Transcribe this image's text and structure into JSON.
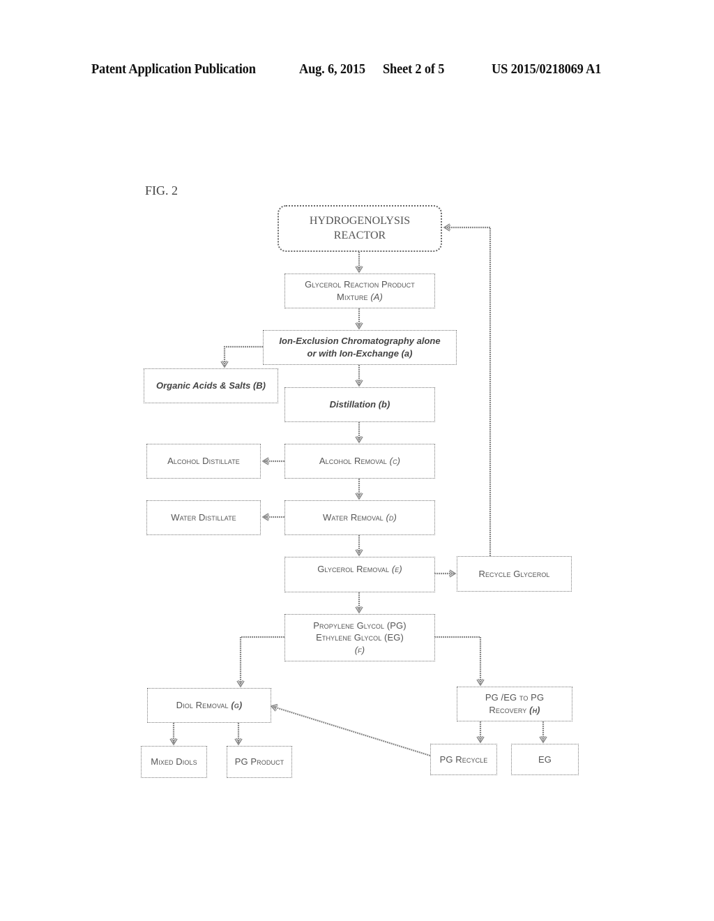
{
  "header": {
    "publication": "Patent Application Publication",
    "date": "Aug. 6, 2015",
    "sheet": "Sheet 2 of 5",
    "number": "US 2015/0218069 A1"
  },
  "figure": {
    "label": "FIG. 2"
  },
  "nodes": {
    "reactor": {
      "line1": "HYDROGENOLYSIS",
      "line2": "REACTOR"
    },
    "mixture": {
      "line1": "Glycerol Reaction Product",
      "line2": "Mixture",
      "tag": "(A)"
    },
    "ion_exclusion": {
      "line1": "Ion-Exclusion Chromatography alone",
      "line2": "or with Ion-Exchange (a)"
    },
    "organic_acids": {
      "label": "Organic Acids & Salts (B)"
    },
    "distillation": {
      "label": "Distillation (b)"
    },
    "alcohol_removal": {
      "label": "Alcohol Removal",
      "tag": "(c)"
    },
    "alcohol_distillate": {
      "label": "Alcohol Distillate"
    },
    "water_removal": {
      "label": "Water Removal",
      "tag": "(d)"
    },
    "water_distillate": {
      "label": "Water Distillate"
    },
    "glycerol_removal": {
      "label": "Glycerol Removal",
      "tag": "(e)"
    },
    "recycle_glycerol": {
      "label": "Recycle Glycerol"
    },
    "pg_eg": {
      "line1": "Propylene Glycol (PG)",
      "line2": "Ethylene Glycol (EG)",
      "tag": "(f)"
    },
    "diol_removal": {
      "label": "Diol Removal",
      "tag": "(g)"
    },
    "pg_eg_recovery": {
      "line1": "PG /EG to PG",
      "line2": "Recovery",
      "tag": "(h)"
    },
    "mixed_diols": {
      "label": "Mixed Diols"
    },
    "pg_product": {
      "label": "PG Product"
    },
    "pg_recycle": {
      "label": "PG Recycle"
    },
    "eg": {
      "label": "EG"
    }
  },
  "colors": {
    "line": "#8a8a8a",
    "text": "#555555",
    "header_text": "#111111"
  }
}
